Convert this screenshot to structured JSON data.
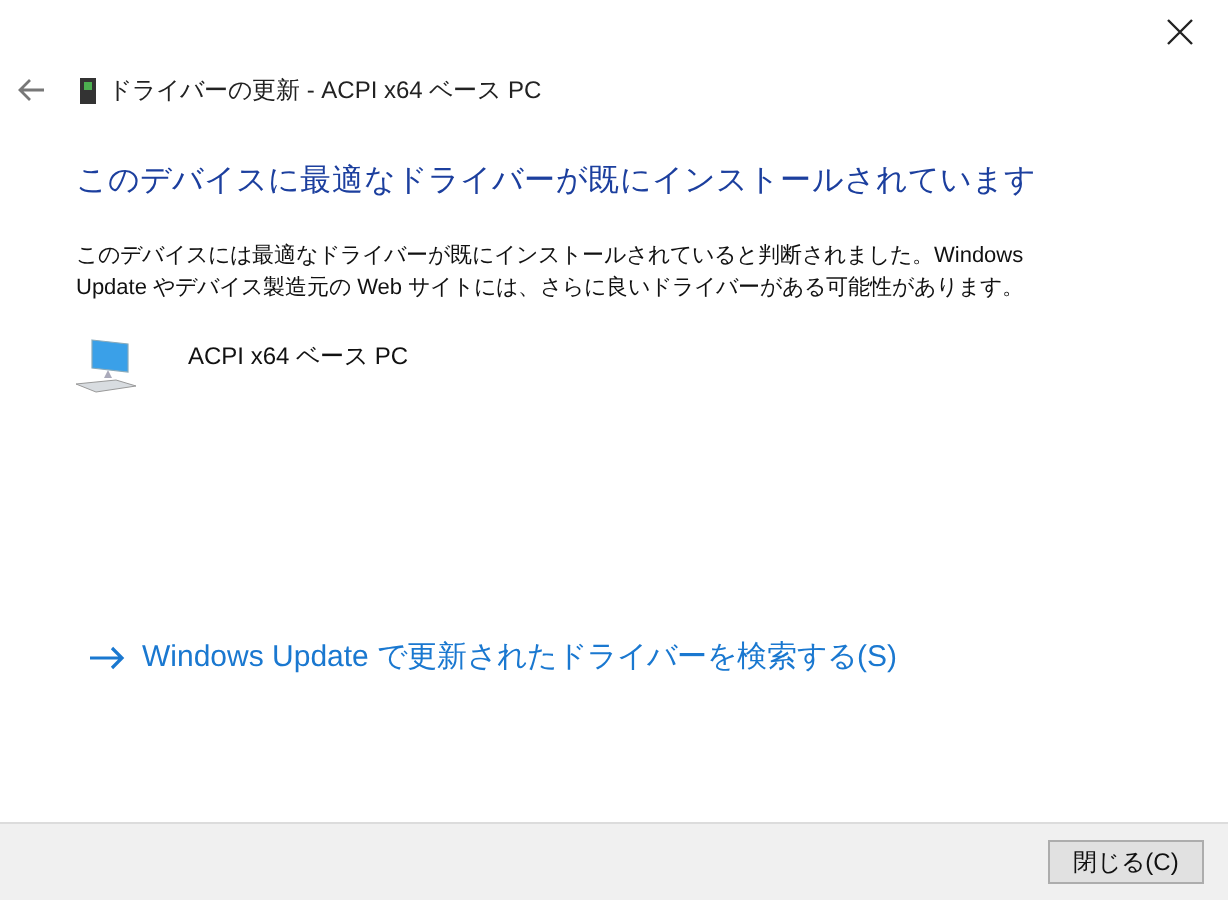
{
  "window": {
    "title": "ドライバーの更新 - ACPI x64 ベース PC"
  },
  "heading": "このデバイスに最適なドライバーが既にインストールされています",
  "message": "このデバイスには最適なドライバーが既にインストールされていると判断されました。Windows Update やデバイス製造元の Web サイトには、さらに良いドライバーがある可能性があります。",
  "device": {
    "name": "ACPI x64 ベース PC"
  },
  "link": "Windows Update で更新されたドライバーを検索する(S)",
  "buttons": [
    "閉じる(C)"
  ]
}
